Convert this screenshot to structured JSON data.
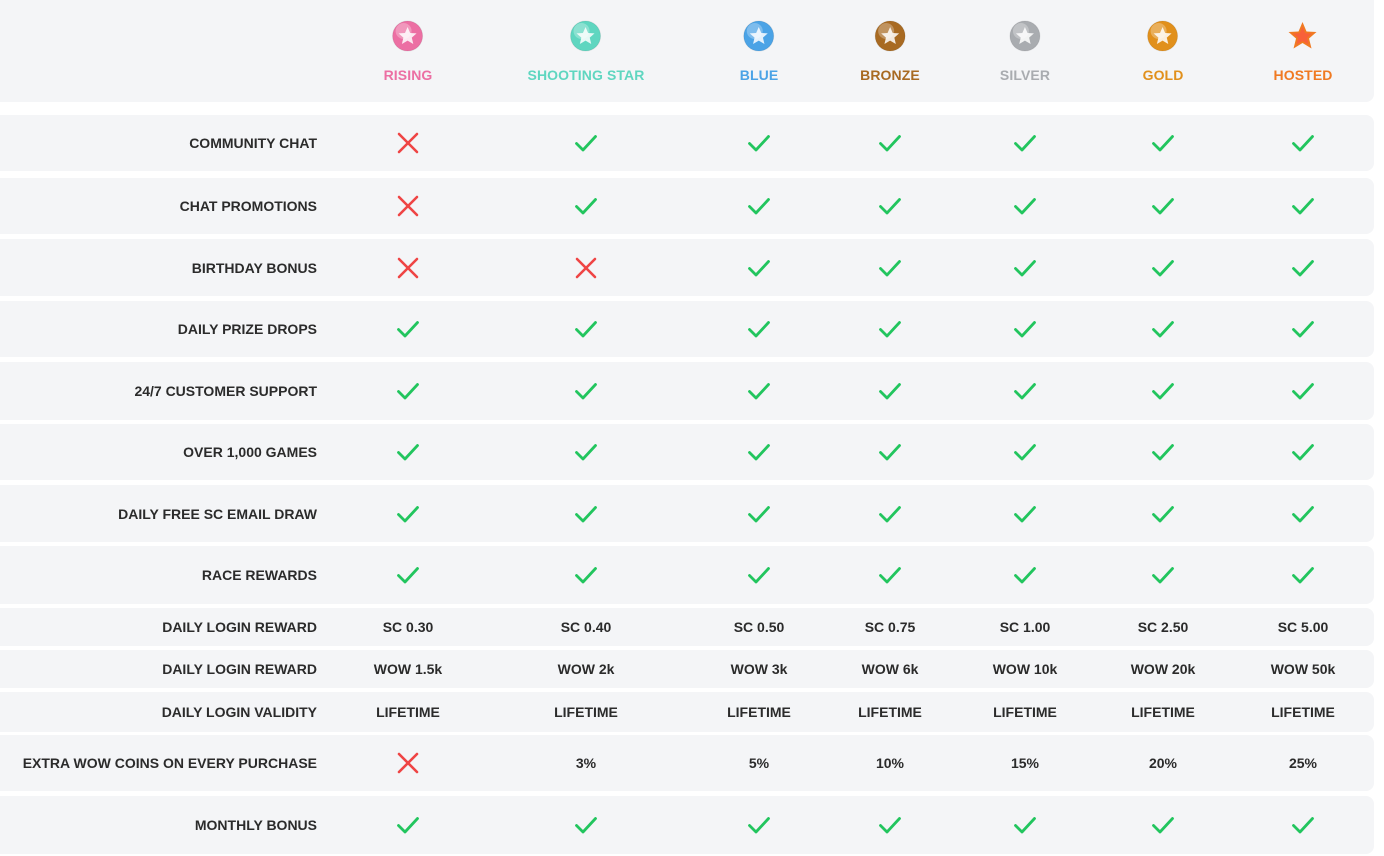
{
  "tiers": [
    {
      "name": "RISING",
      "color": "#ec6fa3",
      "badge": "rising-badge-icon"
    },
    {
      "name": "SHOOTING STAR",
      "color": "#5fd6c0",
      "badge": "shooting-star-badge-icon"
    },
    {
      "name": "BLUE",
      "color": "#4ba3e6",
      "badge": "blue-badge-icon"
    },
    {
      "name": "BRONZE",
      "color": "#a86a22",
      "badge": "bronze-badge-icon"
    },
    {
      "name": "SILVER",
      "color": "#a9acb0",
      "badge": "silver-badge-icon"
    },
    {
      "name": "GOLD",
      "color": "#e1901c",
      "badge": "gold-badge-icon"
    },
    {
      "name": "HOSTED",
      "color": "#f07a22",
      "badge": "hosted-badge-icon"
    }
  ],
  "colors": {
    "check": "#22c55e",
    "cross": "#ef4444",
    "row_bg": "#f4f5f7",
    "text": "#2b2b2b"
  },
  "rows": [
    {
      "label": "COMMUNITY CHAT",
      "values": [
        "cross",
        "check",
        "check",
        "check",
        "check",
        "check",
        "check"
      ]
    },
    {
      "label": "CHAT PROMOTIONS",
      "values": [
        "cross",
        "check",
        "check",
        "check",
        "check",
        "check",
        "check"
      ]
    },
    {
      "label": "BIRTHDAY BONUS",
      "values": [
        "cross",
        "cross",
        "check",
        "check",
        "check",
        "check",
        "check"
      ]
    },
    {
      "label": "DAILY PRIZE DROPS",
      "values": [
        "check",
        "check",
        "check",
        "check",
        "check",
        "check",
        "check"
      ]
    },
    {
      "label": "24/7 CUSTOMER SUPPORT",
      "values": [
        "check",
        "check",
        "check",
        "check",
        "check",
        "check",
        "check"
      ]
    },
    {
      "label": "OVER 1,000 GAMES",
      "values": [
        "check",
        "check",
        "check",
        "check",
        "check",
        "check",
        "check"
      ]
    },
    {
      "label": "DAILY FREE SC EMAIL DRAW",
      "values": [
        "check",
        "check",
        "check",
        "check",
        "check",
        "check",
        "check"
      ]
    },
    {
      "label": "RACE REWARDS",
      "values": [
        "check",
        "check",
        "check",
        "check",
        "check",
        "check",
        "check"
      ]
    },
    {
      "label": "DAILY LOGIN REWARD",
      "values": [
        "SC 0.30",
        "SC 0.40",
        "SC 0.50",
        "SC 0.75",
        "SC 1.00",
        "SC 2.50",
        "SC 5.00"
      ]
    },
    {
      "label": "DAILY LOGIN REWARD",
      "values": [
        "WOW 1.5k",
        "WOW 2k",
        "WOW 3k",
        "WOW 6k",
        "WOW 10k",
        "WOW 20k",
        "WOW 50k"
      ]
    },
    {
      "label": "DAILY LOGIN VALIDITY",
      "values": [
        "LIFETIME",
        "LIFETIME",
        "LIFETIME",
        "LIFETIME",
        "LIFETIME",
        "LIFETIME",
        "LIFETIME"
      ]
    },
    {
      "label": "EXTRA WOW COINS ON EVERY PURCHASE",
      "values": [
        "cross",
        "3%",
        "5%",
        "10%",
        "15%",
        "20%",
        "25%"
      ]
    },
    {
      "label": "MONTHLY BONUS",
      "values": [
        "check",
        "check",
        "check",
        "check",
        "check",
        "check",
        "check"
      ]
    }
  ]
}
